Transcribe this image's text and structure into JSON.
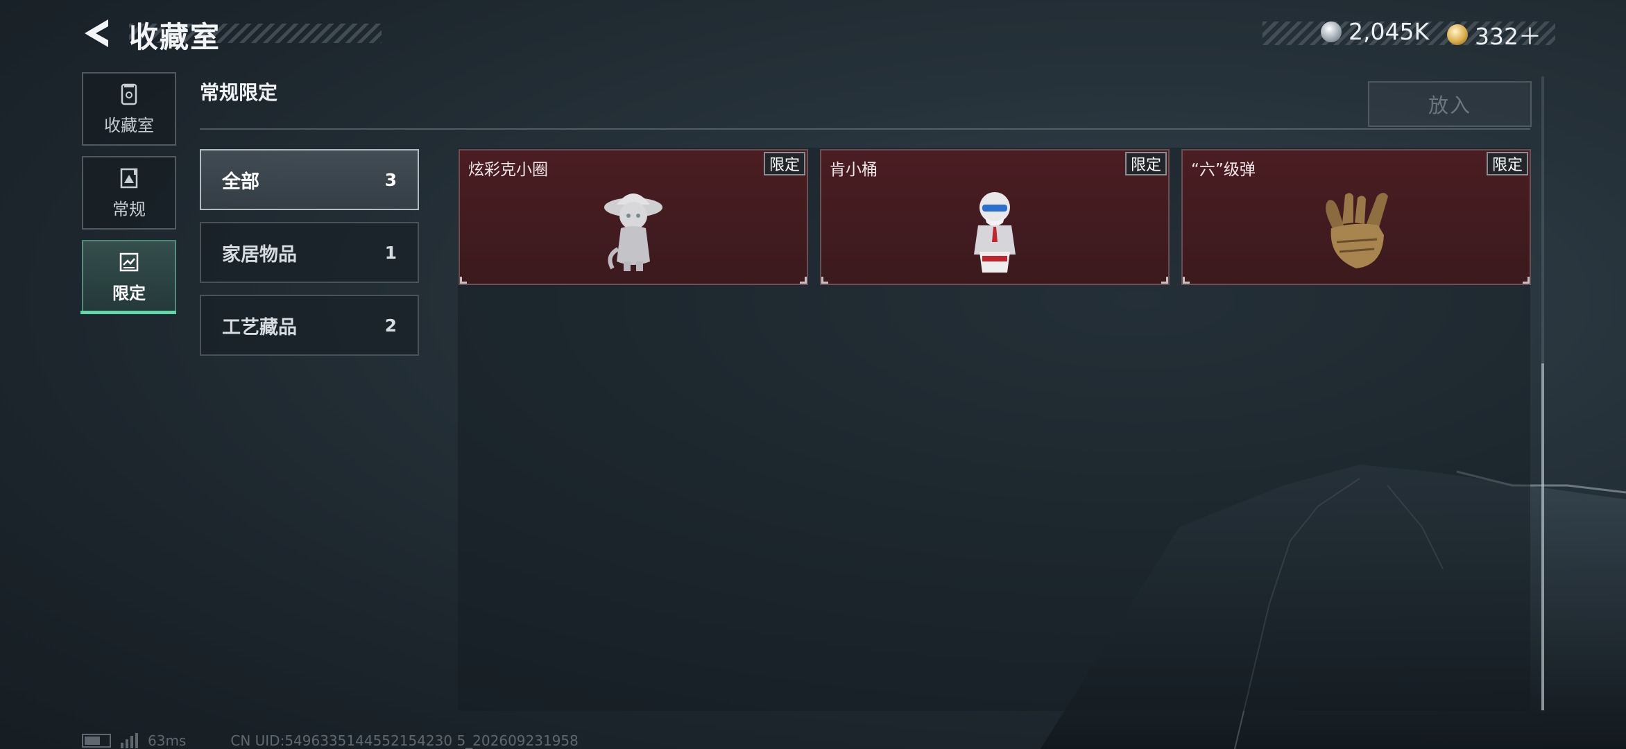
{
  "header": {
    "title": "收藏室",
    "currencies": [
      {
        "icon": "silver-coin-icon",
        "value": "2,045K"
      },
      {
        "icon": "gold-coin-icon",
        "value": "332＋"
      }
    ]
  },
  "nav": {
    "items": [
      {
        "label": "收藏室",
        "icon": "collection-room-icon",
        "active": false
      },
      {
        "label": "常规",
        "icon": "regular-icon",
        "active": false
      },
      {
        "label": "限定",
        "icon": "limited-icon",
        "active": true
      }
    ]
  },
  "section": {
    "title": "常规限定",
    "put_button": "放入"
  },
  "categories": [
    {
      "name": "全部",
      "count": "3",
      "selected": true
    },
    {
      "name": "家居物品",
      "count": "1",
      "selected": false
    },
    {
      "name": "工艺藏品",
      "count": "2",
      "selected": false
    }
  ],
  "items": [
    {
      "name": "炫彩克小圈",
      "tag": "限定",
      "icon": "figurine-girl-icon"
    },
    {
      "name": "肯小桶",
      "tag": "限定",
      "icon": "figurine-colonel-icon"
    },
    {
      "name": "“六”级弹",
      "tag": "限定",
      "icon": "hand-sculpture-icon"
    }
  ],
  "footer": {
    "ping": "63ms",
    "uid": "CN UID:5496335144552154230 5_202609231958"
  },
  "colors": {
    "accent": "#5fd7a6",
    "card_bg": "#4a1d22"
  }
}
